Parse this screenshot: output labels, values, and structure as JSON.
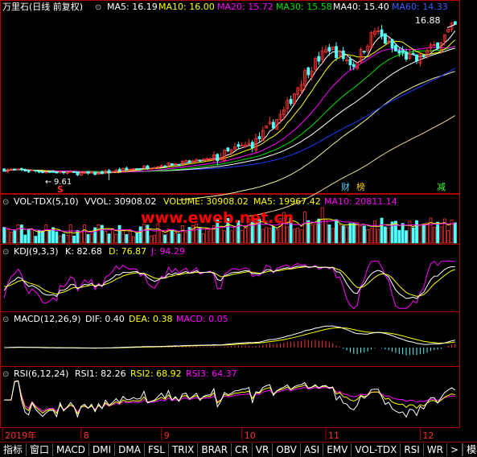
{
  "colors": {
    "bg": "#000000",
    "border": "#b00000",
    "up": "#ff3232",
    "down": "#54ffff",
    "ma5": "#ffffff",
    "ma10": "#ffff00",
    "ma20": "#ff00ff",
    "ma30": "#00e000",
    "ma40": "#ffffff",
    "ma60": "#1e3cff",
    "label": "#ffffff",
    "watermark": "#ff0000",
    "dif": "#ffffff",
    "dea": "#ffff00",
    "macd": "#ff00ff"
  },
  "header": {
    "stock": "万里石(日线 前复权)",
    "icon": "chevron-down-icon",
    "ma5": "MA5: 16.19",
    "ma10": "MA10: 16.00",
    "ma20": "MA20: 15.72",
    "ma30": "MA30: 15.58",
    "ma40": "MA40: 15.40",
    "ma60": "MA60: 14.33"
  },
  "price_panel": {
    "high_label": "16.88",
    "low_label": "9.61",
    "markers": [
      "S",
      "财",
      "榜",
      "减"
    ]
  },
  "vol_panel": {
    "title": "VOL-TDX(5,10)",
    "vvol": "VVOL: 30908.02",
    "volume": "VOLUME: 30908.02",
    "ma5": "MA5: 19967.42",
    "ma10": "MA10: 20811.14"
  },
  "watermark": "www.eweb.net.cn",
  "kdj_panel": {
    "title": "KDJ(9,3,3)",
    "k": "K: 82.68",
    "d": "D: 76.87",
    "j": "J: 94.29"
  },
  "macd_panel": {
    "title": "MACD(12,26,9)",
    "dif": "DIF: 0.40",
    "dea": "DEA: 0.38",
    "macd": "MACD: 0.05"
  },
  "rsi_panel": {
    "title": "RSI(6,12,24)",
    "rsi1": "RSI1: 82.26",
    "rsi2": "RSI2: 68.92",
    "rsi3": "RSI3: 64.37"
  },
  "x_axis": {
    "labels": [
      "2019年",
      "8",
      "9",
      "10",
      "11",
      "12"
    ]
  },
  "tabs": [
    "指标",
    "窗口",
    "MACD",
    "DMI",
    "DMA",
    "FSL",
    "TRIX",
    "BRAR",
    "CR",
    "VR",
    "OBV",
    "ASI",
    "EMV",
    "VOL-TDX",
    "RSI",
    "WR",
    ">"
  ],
  "tab_right": "模板",
  "chart_data": {
    "type": "candlestick",
    "seed": 7,
    "bars": 130,
    "price_range": [
      9.61,
      16.88
    ],
    "last_close": 16.88,
    "ma_last": {
      "MA5": 16.19,
      "MA10": 16.0,
      "MA20": 15.72,
      "MA30": 15.58,
      "MA40": 15.4,
      "MA60": 14.33
    },
    "volume_last": {
      "VOLUME": 30908.02,
      "MA5": 19967.42,
      "MA10": 20811.14
    },
    "kdj_last": {
      "K": 82.68,
      "D": 76.87,
      "J": 94.29
    },
    "macd_last": {
      "DIF": 0.4,
      "DEA": 0.38,
      "MACD": 0.05
    },
    "rsi_last": {
      "RSI1": 82.26,
      "RSI2": 68.92,
      "RSI3": 64.37
    },
    "months": [
      "2019年",
      "8",
      "9",
      "10",
      "11",
      "12"
    ]
  }
}
